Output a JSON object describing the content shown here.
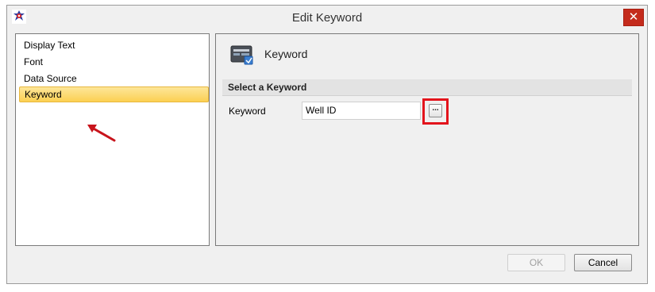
{
  "window": {
    "title": "Edit Keyword",
    "close_label": "✕"
  },
  "sidebar": {
    "items": [
      {
        "label": "Display Text"
      },
      {
        "label": "Font"
      },
      {
        "label": "Data Source"
      },
      {
        "label": "Keyword",
        "selected": true
      }
    ]
  },
  "main": {
    "heading": "Keyword",
    "heading_icon": "keyword-icon",
    "group_title": "Select a Keyword",
    "field_label": "Keyword",
    "field_value": "Well ID",
    "browse_label": "..."
  },
  "footer": {
    "ok_label": "OK",
    "ok_enabled": false,
    "cancel_label": "Cancel"
  },
  "colors": {
    "selection": "#fcd052",
    "annotation": "#e3141c",
    "close_button": "#c42b1c"
  }
}
